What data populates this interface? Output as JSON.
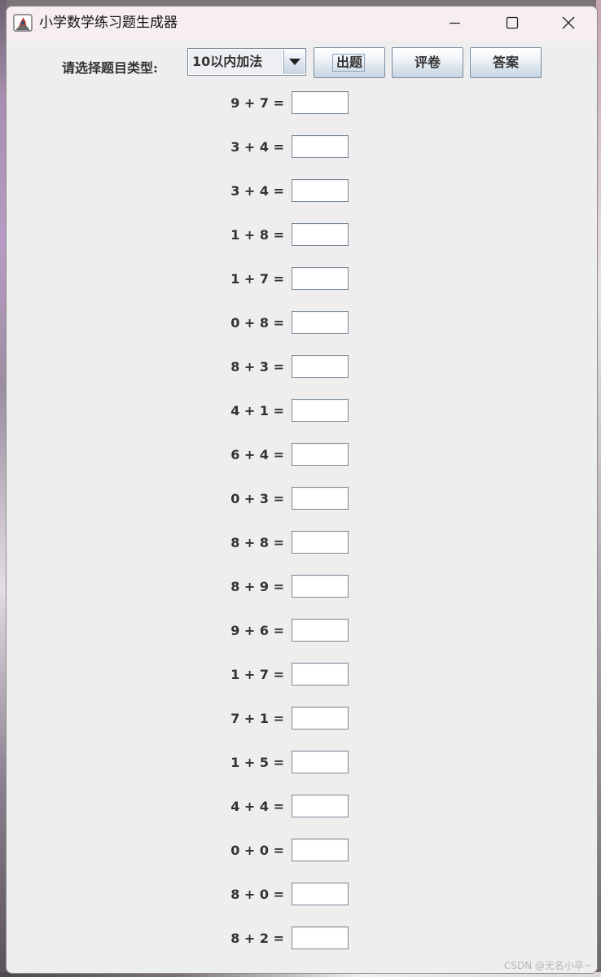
{
  "window": {
    "title": "小学数学练习题生成器"
  },
  "toolbar": {
    "type_label": "请选择题目类型:",
    "type_selected": "10以内加法",
    "issue_label": "出题",
    "grade_label": "评卷",
    "answer_label": "答案"
  },
  "problems": [
    {
      "expr": "9 + 7 =",
      "answer": ""
    },
    {
      "expr": "3 + 4 =",
      "answer": ""
    },
    {
      "expr": "3 + 4 =",
      "answer": ""
    },
    {
      "expr": "1 + 8 =",
      "answer": ""
    },
    {
      "expr": "1 + 7 =",
      "answer": ""
    },
    {
      "expr": "0 + 8 =",
      "answer": ""
    },
    {
      "expr": "8 + 3 =",
      "answer": ""
    },
    {
      "expr": "4 + 1 =",
      "answer": ""
    },
    {
      "expr": "6 + 4 =",
      "answer": ""
    },
    {
      "expr": "0 + 3 =",
      "answer": ""
    },
    {
      "expr": "8 + 8 =",
      "answer": ""
    },
    {
      "expr": "8 + 9 =",
      "answer": ""
    },
    {
      "expr": "9 + 6 =",
      "answer": ""
    },
    {
      "expr": "1 + 7 =",
      "answer": ""
    },
    {
      "expr": "7 + 1 =",
      "answer": ""
    },
    {
      "expr": "1 + 5 =",
      "answer": ""
    },
    {
      "expr": "4 + 4 =",
      "answer": ""
    },
    {
      "expr": "0 + 0 =",
      "answer": ""
    },
    {
      "expr": "8 + 0 =",
      "answer": ""
    },
    {
      "expr": "8 + 2 =",
      "answer": ""
    }
  ],
  "watermark": "CSDN @无名小卒~",
  "icons": {
    "app": "java-app-icon",
    "minimize": "minimize-icon",
    "maximize": "maximize-icon",
    "close": "close-icon",
    "dropdown": "dropdown-arrow-icon"
  },
  "colors": {
    "titlebar_bg": "#f7eef0",
    "window_bg": "#eeeeee",
    "text": "#333333",
    "button_border": "#7b8d9f"
  }
}
